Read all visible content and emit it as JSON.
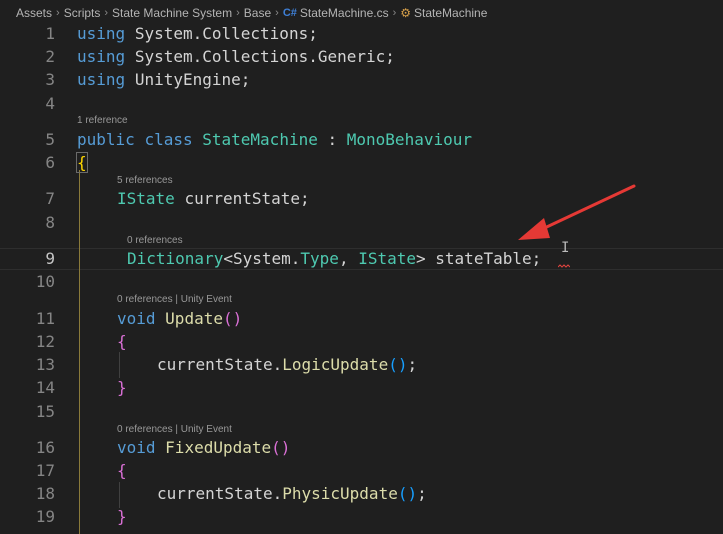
{
  "breadcrumb": {
    "items": [
      "Assets",
      "Scripts",
      "State Machine System",
      "Base"
    ],
    "file_icon": "C#",
    "file": "StateMachine.cs",
    "symbol": "StateMachine"
  },
  "lines": {
    "n1": "1",
    "n2": "2",
    "n3": "3",
    "n4": "4",
    "n5": "5",
    "n6": "6",
    "n7": "7",
    "n8": "8",
    "n9": "9",
    "n10": "10",
    "n11": "11",
    "n12": "12",
    "n13": "13",
    "n14": "14",
    "n15": "15",
    "n16": "16",
    "n17": "17",
    "n18": "18",
    "n19": "19"
  },
  "lens": {
    "class_refs": "1 reference",
    "state_refs": "5 references",
    "table_refs": "0 references",
    "update_refs": "0 references | Unity Event",
    "fixed_refs": "0 references | Unity Event"
  },
  "code": {
    "using": "using",
    "ns1": "System.Collections;",
    "ns2": "System.Collections.Generic;",
    "ns3": "UnityEngine;",
    "public": "public",
    "class": "class",
    "class_name": "StateMachine",
    "colon": ":",
    "base_class": "MonoBehaviour",
    "open_brace": "{",
    "close_brace": "}",
    "istate": "IState",
    "current_state_field": "currentState;",
    "dictionary": "Dictionary",
    "lt": "<",
    "system": "System.",
    "type": "Type",
    "comma": ", ",
    "gt": ">",
    "state_table": "stateTable;",
    "void": "void",
    "update": "Update",
    "fixed_update": "FixedUpdate",
    "parens_open": "(",
    "parens_close": ")",
    "current_state": "currentState",
    "dot": ".",
    "logic_update": "LogicUpdate",
    "physic_update": "PhysicUpdate",
    "call_end": "();"
  },
  "colors": {
    "keyword": "#569cd6",
    "type": "#4ec9b0",
    "function": "#dcdcaa",
    "bracket_gold": "#ffd700",
    "bracket_purple": "#da70d6",
    "bracket_blue": "#179fff",
    "arrow": "#e53935"
  },
  "annotation": {
    "icon": "red-arrow-icon"
  }
}
